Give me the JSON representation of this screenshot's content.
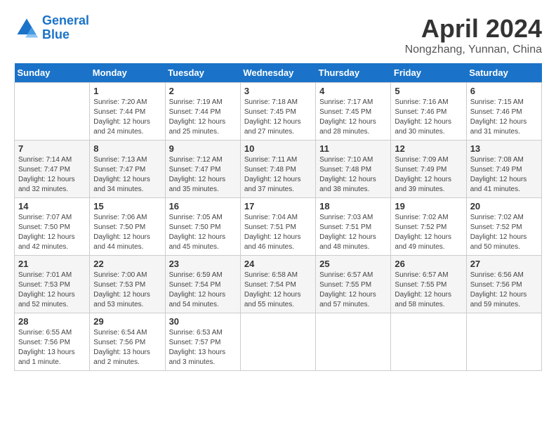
{
  "logo": {
    "line1": "General",
    "line2": "Blue"
  },
  "title": "April 2024",
  "subtitle": "Nongzhang, Yunnan, China",
  "days_of_week": [
    "Sunday",
    "Monday",
    "Tuesday",
    "Wednesday",
    "Thursday",
    "Friday",
    "Saturday"
  ],
  "weeks": [
    [
      {
        "day": "",
        "info": ""
      },
      {
        "day": "1",
        "info": "Sunrise: 7:20 AM\nSunset: 7:44 PM\nDaylight: 12 hours\nand 24 minutes."
      },
      {
        "day": "2",
        "info": "Sunrise: 7:19 AM\nSunset: 7:44 PM\nDaylight: 12 hours\nand 25 minutes."
      },
      {
        "day": "3",
        "info": "Sunrise: 7:18 AM\nSunset: 7:45 PM\nDaylight: 12 hours\nand 27 minutes."
      },
      {
        "day": "4",
        "info": "Sunrise: 7:17 AM\nSunset: 7:45 PM\nDaylight: 12 hours\nand 28 minutes."
      },
      {
        "day": "5",
        "info": "Sunrise: 7:16 AM\nSunset: 7:46 PM\nDaylight: 12 hours\nand 30 minutes."
      },
      {
        "day": "6",
        "info": "Sunrise: 7:15 AM\nSunset: 7:46 PM\nDaylight: 12 hours\nand 31 minutes."
      }
    ],
    [
      {
        "day": "7",
        "info": "Sunrise: 7:14 AM\nSunset: 7:47 PM\nDaylight: 12 hours\nand 32 minutes."
      },
      {
        "day": "8",
        "info": "Sunrise: 7:13 AM\nSunset: 7:47 PM\nDaylight: 12 hours\nand 34 minutes."
      },
      {
        "day": "9",
        "info": "Sunrise: 7:12 AM\nSunset: 7:47 PM\nDaylight: 12 hours\nand 35 minutes."
      },
      {
        "day": "10",
        "info": "Sunrise: 7:11 AM\nSunset: 7:48 PM\nDaylight: 12 hours\nand 37 minutes."
      },
      {
        "day": "11",
        "info": "Sunrise: 7:10 AM\nSunset: 7:48 PM\nDaylight: 12 hours\nand 38 minutes."
      },
      {
        "day": "12",
        "info": "Sunrise: 7:09 AM\nSunset: 7:49 PM\nDaylight: 12 hours\nand 39 minutes."
      },
      {
        "day": "13",
        "info": "Sunrise: 7:08 AM\nSunset: 7:49 PM\nDaylight: 12 hours\nand 41 minutes."
      }
    ],
    [
      {
        "day": "14",
        "info": "Sunrise: 7:07 AM\nSunset: 7:50 PM\nDaylight: 12 hours\nand 42 minutes."
      },
      {
        "day": "15",
        "info": "Sunrise: 7:06 AM\nSunset: 7:50 PM\nDaylight: 12 hours\nand 44 minutes."
      },
      {
        "day": "16",
        "info": "Sunrise: 7:05 AM\nSunset: 7:50 PM\nDaylight: 12 hours\nand 45 minutes."
      },
      {
        "day": "17",
        "info": "Sunrise: 7:04 AM\nSunset: 7:51 PM\nDaylight: 12 hours\nand 46 minutes."
      },
      {
        "day": "18",
        "info": "Sunrise: 7:03 AM\nSunset: 7:51 PM\nDaylight: 12 hours\nand 48 minutes."
      },
      {
        "day": "19",
        "info": "Sunrise: 7:02 AM\nSunset: 7:52 PM\nDaylight: 12 hours\nand 49 minutes."
      },
      {
        "day": "20",
        "info": "Sunrise: 7:02 AM\nSunset: 7:52 PM\nDaylight: 12 hours\nand 50 minutes."
      }
    ],
    [
      {
        "day": "21",
        "info": "Sunrise: 7:01 AM\nSunset: 7:53 PM\nDaylight: 12 hours\nand 52 minutes."
      },
      {
        "day": "22",
        "info": "Sunrise: 7:00 AM\nSunset: 7:53 PM\nDaylight: 12 hours\nand 53 minutes."
      },
      {
        "day": "23",
        "info": "Sunrise: 6:59 AM\nSunset: 7:54 PM\nDaylight: 12 hours\nand 54 minutes."
      },
      {
        "day": "24",
        "info": "Sunrise: 6:58 AM\nSunset: 7:54 PM\nDaylight: 12 hours\nand 55 minutes."
      },
      {
        "day": "25",
        "info": "Sunrise: 6:57 AM\nSunset: 7:55 PM\nDaylight: 12 hours\nand 57 minutes."
      },
      {
        "day": "26",
        "info": "Sunrise: 6:57 AM\nSunset: 7:55 PM\nDaylight: 12 hours\nand 58 minutes."
      },
      {
        "day": "27",
        "info": "Sunrise: 6:56 AM\nSunset: 7:56 PM\nDaylight: 12 hours\nand 59 minutes."
      }
    ],
    [
      {
        "day": "28",
        "info": "Sunrise: 6:55 AM\nSunset: 7:56 PM\nDaylight: 13 hours\nand 1 minute."
      },
      {
        "day": "29",
        "info": "Sunrise: 6:54 AM\nSunset: 7:56 PM\nDaylight: 13 hours\nand 2 minutes."
      },
      {
        "day": "30",
        "info": "Sunrise: 6:53 AM\nSunset: 7:57 PM\nDaylight: 13 hours\nand 3 minutes."
      },
      {
        "day": "",
        "info": ""
      },
      {
        "day": "",
        "info": ""
      },
      {
        "day": "",
        "info": ""
      },
      {
        "day": "",
        "info": ""
      }
    ]
  ]
}
